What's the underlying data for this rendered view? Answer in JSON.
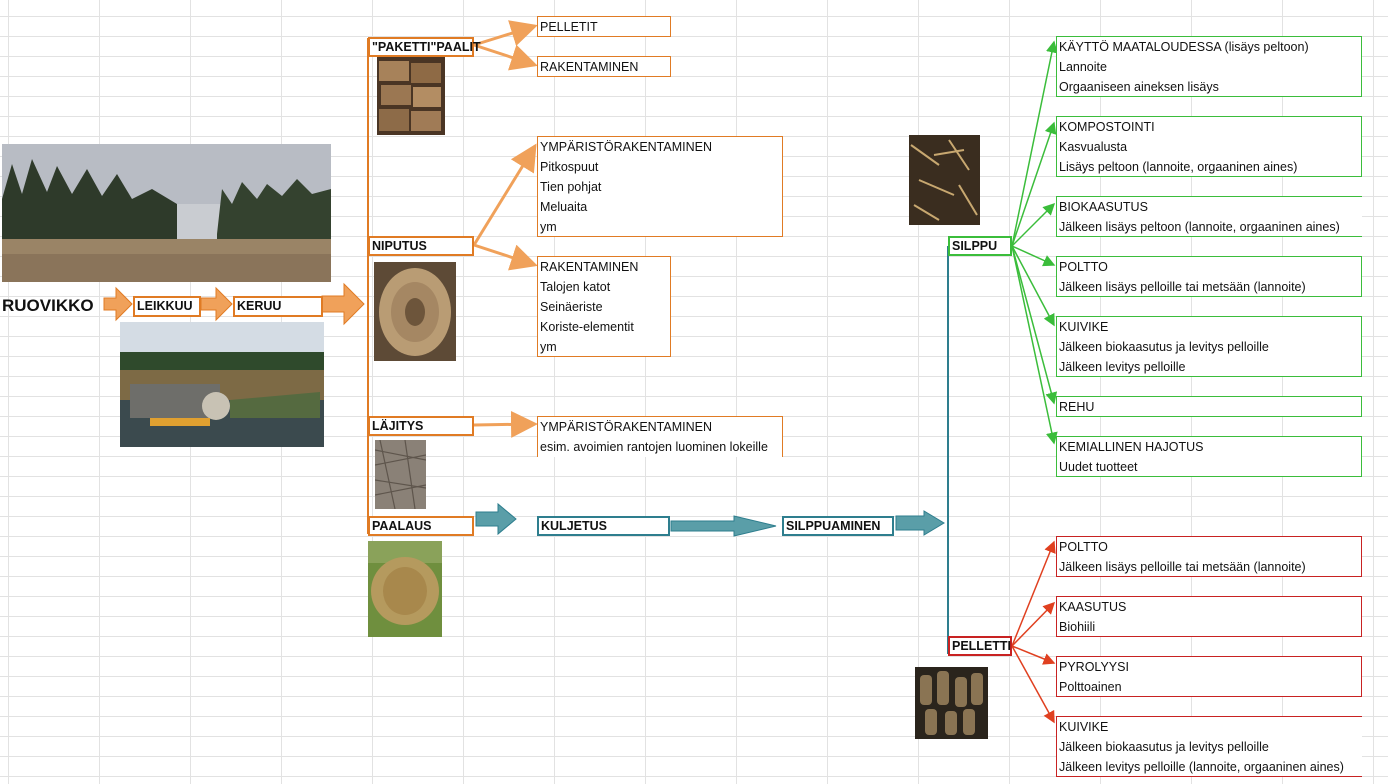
{
  "start": {
    "label": "RUOVIKKO"
  },
  "steps": {
    "leikkuu": "LEIKKUU",
    "keruu": "KERUU"
  },
  "branches": {
    "paketti": "\"PAKETTI\"PAALIT",
    "niputus": "NIPUTUS",
    "lajitys": "LÄJITYS",
    "paalaus": "PAALAUS"
  },
  "chain": {
    "kuljetus": "KULJETUS",
    "silppuaminen": "SILPPUAMINEN"
  },
  "products": {
    "silppu": "SILPPU",
    "pelletti": "PELLETTI"
  },
  "paketti_uses": [
    {
      "lines": [
        "PELLETIT"
      ]
    },
    {
      "lines": [
        "RAKENTAMINEN"
      ]
    }
  ],
  "niputus_uses": [
    {
      "lines": [
        "YMPÄRISTÖRAKENTAMINEN",
        "Pitkospuut",
        "Tien pohjat",
        "Meluaita",
        "ym"
      ]
    },
    {
      "lines": [
        "RAKENTAMINEN",
        "Talojen katot",
        "Seinäeriste",
        "Koriste-elementit",
        "ym"
      ]
    }
  ],
  "lajitys_uses": [
    {
      "lines": [
        "YMPÄRISTÖRAKENTAMINEN",
        "esim. avoimien rantojen luominen lokeille"
      ]
    }
  ],
  "silppu_uses": [
    {
      "lines": [
        "KÄYTTÖ MAATALOUDESSA (lisäys peltoon)",
        "Lannoite",
        "Orgaaniseen aineksen lisäys"
      ]
    },
    {
      "lines": [
        "KOMPOSTOINTI",
        "Kasvualusta",
        "Lisäys peltoon (lannoite, orgaaninen aines)"
      ]
    },
    {
      "lines": [
        "BIOKAASUTUS",
        "Jälkeen lisäys peltoon (lannoite, orgaaninen aines)"
      ]
    },
    {
      "lines": [
        "POLTTO",
        "Jälkeen lisäys pelloille tai metsään (lannoite)"
      ]
    },
    {
      "lines": [
        "KUIVIKE",
        "Jälkeen biokaasutus ja levitys pelloille",
        "Jälkeen levitys pelloille"
      ]
    },
    {
      "lines": [
        "REHU"
      ]
    },
    {
      "lines": [
        "KEMIALLINEN HAJOTUS",
        "Uudet tuotteet"
      ]
    }
  ],
  "pelletti_uses": [
    {
      "lines": [
        "POLTTO",
        "Jälkeen lisäys pelloille tai metsään (lannoite)"
      ]
    },
    {
      "lines": [
        "KAASUTUS",
        "Biohiili"
      ]
    },
    {
      "lines": [
        "PYROLYYSI",
        "Polttoainen"
      ]
    },
    {
      "lines": [
        "KUIVIKE",
        "Jälkeen biokaasutus ja levitys pelloille",
        "Jälkeen levitys pelloille (lannoite, orgaaninen aines)"
      ]
    }
  ],
  "colors": {
    "orange": "#e07b24",
    "arrow_orange": "#f0a15a",
    "teal": "#2e7e8e",
    "green": "#3bbd3b",
    "red": "#c82222"
  }
}
